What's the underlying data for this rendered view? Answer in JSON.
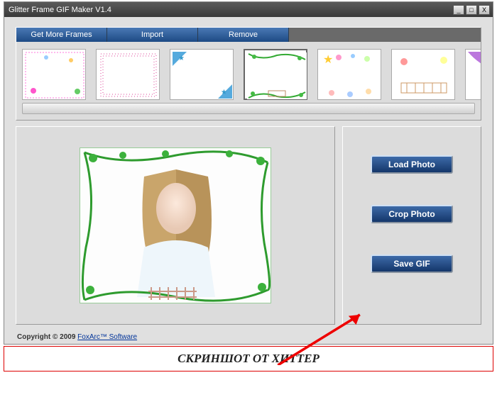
{
  "titlebar": {
    "title": "Glitter Frame GIF Maker V1.4",
    "min": "_",
    "max": "□",
    "close": "X"
  },
  "tabs": {
    "get_more": "Get More Frames",
    "import": "Import",
    "remove": "Remove"
  },
  "thumbs": [
    {
      "name": "frame-hearts"
    },
    {
      "name": "frame-pink-dots"
    },
    {
      "name": "frame-blue-stars"
    },
    {
      "name": "frame-green-vine",
      "selected": true
    },
    {
      "name": "frame-star-bubbles"
    },
    {
      "name": "frame-wattle-fence"
    },
    {
      "name": "frame-purple-corner"
    }
  ],
  "actions": {
    "load": "Load Photo",
    "crop": "Crop Photo",
    "save": "Save GIF"
  },
  "footer": {
    "copyright": "Copyright © 2009 ",
    "link": "FoxArc™ Software"
  },
  "caption": "СКРИНШОТ ОТ ХИТТЕР"
}
